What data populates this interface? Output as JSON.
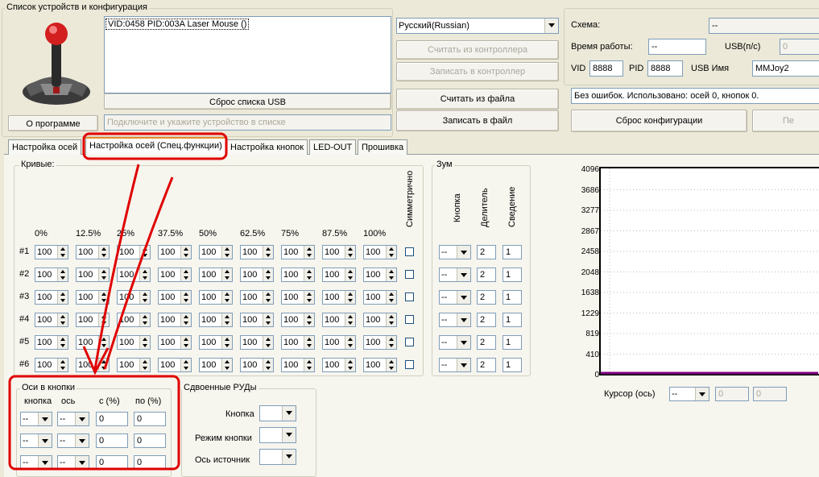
{
  "devices_group_title": "Список устройств и конфигурация",
  "device_list": [
    "VID:0458 PID:003A Laser Mouse ()"
  ],
  "reset_usb_button": "Сброс списка USB",
  "about_button": "О программе",
  "status_hint": "Подключите и укажите устройство в списке",
  "language": "Русский(Russian)",
  "buttons": {
    "read_controller": "Считать из контроллера",
    "write_controller": "Записать в контроллер",
    "read_file": "Считать из файла",
    "write_file": "Записать в файл",
    "reset_config": "Сброс конфигурации",
    "right_cut": "Пе"
  },
  "info": {
    "scheme_label": "Схема:",
    "scheme_value": "--",
    "uptime_label": "Время работы:",
    "uptime_value": "--",
    "usb_ms_label": "USB(п/с)",
    "usb_ms_value": "0",
    "vid_label": "VID",
    "vid_value": "8888",
    "pid_label": "PID",
    "pid_value": "8888",
    "usb_name_label": "USB Имя",
    "usb_name_value": "MMJoy2",
    "status_message": "Без ошибок. Использовано: осей  0, кнопок  0."
  },
  "tabs": [
    "Настройка осей",
    "Настройка осей (Спец.функции)",
    "Настройка кнопок",
    "LED-OUT",
    "Прошивка"
  ],
  "curves": {
    "title": "Кривые:",
    "symmetric_label": "Симметрично",
    "columns": [
      "0%",
      "12.5%",
      "25%",
      "37.5%",
      "50%",
      "62.5%",
      "75%",
      "87.5%",
      "100%"
    ],
    "rows": [
      {
        "label": "#1",
        "values": [
          "100",
          "100",
          "100",
          "100",
          "100",
          "100",
          "100",
          "100",
          "100"
        ]
      },
      {
        "label": "#2",
        "values": [
          "100",
          "100",
          "100",
          "100",
          "100",
          "100",
          "100",
          "100",
          "100"
        ]
      },
      {
        "label": "#3",
        "values": [
          "100",
          "100",
          "100",
          "100",
          "100",
          "100",
          "100",
          "100",
          "100"
        ]
      },
      {
        "label": "#4",
        "values": [
          "100",
          "100",
          "100",
          "100",
          "100",
          "100",
          "100",
          "100",
          "100"
        ]
      },
      {
        "label": "#5",
        "values": [
          "100",
          "100",
          "100",
          "100",
          "100",
          "100",
          "100",
          "100",
          "100"
        ]
      },
      {
        "label": "#6",
        "values": [
          "100",
          "100",
          "100",
          "100",
          "100",
          "100",
          "100",
          "100",
          "100"
        ]
      }
    ]
  },
  "zoom": {
    "title": "Зум",
    "col_button": "Кнопка",
    "col_divider": "Делитель",
    "col_convergence": "Сведение",
    "rows": [
      {
        "button": "--",
        "divider": "2",
        "convergence": "1"
      },
      {
        "button": "--",
        "divider": "2",
        "convergence": "1"
      },
      {
        "button": "--",
        "divider": "2",
        "convergence": "1"
      },
      {
        "button": "--",
        "divider": "2",
        "convergence": "1"
      },
      {
        "button": "--",
        "divider": "2",
        "convergence": "1"
      },
      {
        "button": "--",
        "divider": "2",
        "convergence": "1"
      }
    ]
  },
  "axes_to_buttons": {
    "title": "Оси в кнопки",
    "col_button": "кнопка",
    "col_axis": "ось",
    "col_from": "с (%)",
    "col_to": "по (%)",
    "rows": [
      {
        "button": "--",
        "axis": "--",
        "from": "0",
        "to": "0"
      },
      {
        "button": "--",
        "axis": "--",
        "from": "0",
        "to": "0"
      },
      {
        "button": "--",
        "axis": "--",
        "from": "0",
        "to": "0"
      }
    ]
  },
  "dual_throttle": {
    "title": "Сдвоенные РУДы",
    "button_label": "Кнопка",
    "mode_label": "Режим кнопки",
    "source_label": "Ось источник"
  },
  "chart": {
    "y_ticks": [
      "4096",
      "3686",
      "3277",
      "2867",
      "2458",
      "2048",
      "1638",
      "1229",
      "819",
      "410",
      "0"
    ],
    "cursor_label": "Курсор (ось)",
    "cursor_value": "--",
    "cursor_field1": "0",
    "cursor_field2": "0",
    "line_color": "#800080"
  },
  "annotation_color": "#e00000"
}
